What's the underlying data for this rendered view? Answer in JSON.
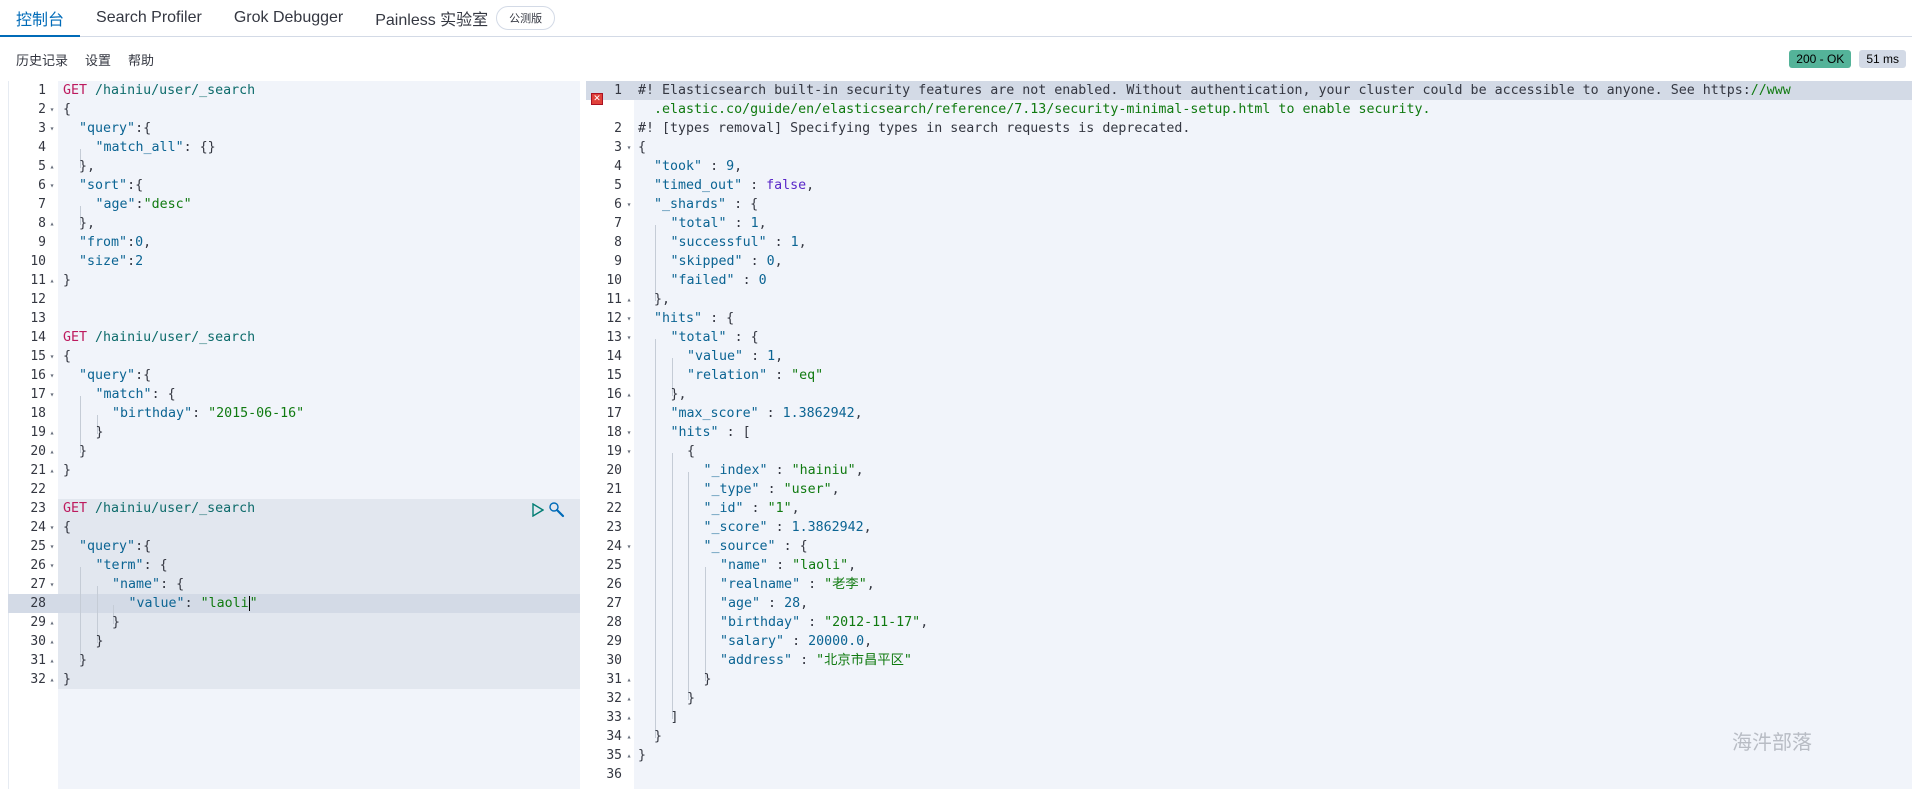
{
  "tabs": [
    {
      "label": "控制台",
      "active": true
    },
    {
      "label": "Search Profiler",
      "active": false
    },
    {
      "label": "Grok Debugger",
      "active": false
    },
    {
      "label": "Painless 实验室",
      "active": false,
      "badge": "公测版"
    }
  ],
  "subbar": {
    "history": "历史记录",
    "settings": "设置",
    "help": "帮助"
  },
  "status": {
    "code": "200 - OK",
    "time": "51 ms",
    "ok_color": "#54b399"
  },
  "request": {
    "lines": [
      {
        "n": "1",
        "fold": "",
        "html": "<span class='m'>GET</span> <span class='url'>/hainiu/user/_search</span>"
      },
      {
        "n": "2",
        "fold": "▾",
        "html": "{"
      },
      {
        "n": "3",
        "fold": "▾",
        "html": "  <span class='k'>\"query\"</span>:{"
      },
      {
        "n": "4",
        "fold": "",
        "html": "  <span class='guide'></span><span class='k'>\"match_all\"</span>: {}"
      },
      {
        "n": "5",
        "fold": "▴",
        "html": "  },"
      },
      {
        "n": "6",
        "fold": "▾",
        "html": "  <span class='k'>\"sort\"</span>:{"
      },
      {
        "n": "7",
        "fold": "",
        "html": "  <span class='guide'></span><span class='k'>\"age\"</span>:<span class='s'>\"desc\"</span>"
      },
      {
        "n": "8",
        "fold": "▴",
        "html": "  },"
      },
      {
        "n": "9",
        "fold": "",
        "html": "  <span class='k'>\"from\"</span>:<span class='n'>0</span>,"
      },
      {
        "n": "10",
        "fold": "",
        "html": "  <span class='k'>\"size\"</span>:<span class='n'>2</span>"
      },
      {
        "n": "11",
        "fold": "▴",
        "html": "}"
      },
      {
        "n": "12",
        "fold": "",
        "html": ""
      },
      {
        "n": "13",
        "fold": "",
        "html": ""
      },
      {
        "n": "14",
        "fold": "",
        "html": "<span class='m'>GET</span> <span class='url'>/hainiu/user/_search</span>"
      },
      {
        "n": "15",
        "fold": "▾",
        "html": "{"
      },
      {
        "n": "16",
        "fold": "▾",
        "html": "  <span class='k'>\"query\"</span>:{"
      },
      {
        "n": "17",
        "fold": "▾",
        "html": "  <span class='guide'></span><span class='k'>\"match\"</span>: {"
      },
      {
        "n": "18",
        "fold": "",
        "html": "  <span class='guide'></span><span class='guide'></span><span class='k'>\"birthday\"</span>: <span class='s'>\"2015-06-16\"</span>"
      },
      {
        "n": "19",
        "fold": "▴",
        "html": "  <span class='guide'></span>}"
      },
      {
        "n": "20",
        "fold": "▴",
        "html": "  }"
      },
      {
        "n": "21",
        "fold": "▴",
        "html": "}"
      },
      {
        "n": "22",
        "fold": "",
        "html": ""
      },
      {
        "n": "23",
        "fold": "",
        "html": "<span class='m'>GET</span> <span class='url'>/hainiu/user/_search</span>"
      },
      {
        "n": "24",
        "fold": "▾",
        "html": "{"
      },
      {
        "n": "25",
        "fold": "▾",
        "html": "  <span class='k'>\"query\"</span>:{"
      },
      {
        "n": "26",
        "fold": "▾",
        "html": "  <span class='guide'></span><span class='k'>\"term\"</span>: {"
      },
      {
        "n": "27",
        "fold": "▾",
        "html": "  <span class='guide'></span><span class='guide'></span><span class='k'>\"name\"</span>: {"
      },
      {
        "n": "28",
        "fold": "",
        "html": "  <span class='guide'></span><span class='guide'></span><span class='guide'></span><span class='k'>\"value\"</span>: <span class='s'>\"laoli</span><span class='cursor'></span><span class='s'>\"</span>"
      },
      {
        "n": "29",
        "fold": "▴",
        "html": "  <span class='guide'></span><span class='guide'></span>}"
      },
      {
        "n": "30",
        "fold": "▴",
        "html": "  <span class='guide'></span>}"
      },
      {
        "n": "31",
        "fold": "▴",
        "html": "  }"
      },
      {
        "n": "32",
        "fold": "▴",
        "html": "}"
      }
    ]
  },
  "response": {
    "lines": [
      {
        "n": "1",
        "fold": "",
        "html": "<span class='c'>#! Elasticsearch built-in security features are not enabled. Without authentication, your cluster could be accessible to anyone. See https:</span><span class='cu'>//www</span>",
        "wrap": "<span class='cu'>  .elastic.co/guide/en/elasticsearch/reference/7.13/security-minimal-setup.html to enable security.</span>"
      },
      {
        "n": "2",
        "fold": "",
        "html": "<span class='c'>#! [types removal] Specifying types in search requests is deprecated.</span>"
      },
      {
        "n": "3",
        "fold": "▾",
        "html": "{"
      },
      {
        "n": "4",
        "fold": "",
        "html": "  <span class='k'>\"took\"</span> : <span class='n'>9</span>,"
      },
      {
        "n": "5",
        "fold": "",
        "html": "  <span class='k'>\"timed_out\"</span> : <span class='b'>false</span>,"
      },
      {
        "n": "6",
        "fold": "▾",
        "html": "  <span class='k'>\"_shards\"</span> : {"
      },
      {
        "n": "7",
        "fold": "",
        "html": "  <span class='guide'></span><span class='k'>\"total\"</span> : <span class='n'>1</span>,"
      },
      {
        "n": "8",
        "fold": "",
        "html": "  <span class='guide'></span><span class='k'>\"successful\"</span> : <span class='n'>1</span>,"
      },
      {
        "n": "9",
        "fold": "",
        "html": "  <span class='guide'></span><span class='k'>\"skipped\"</span> : <span class='n'>0</span>,"
      },
      {
        "n": "10",
        "fold": "",
        "html": "  <span class='guide'></span><span class='k'>\"failed\"</span> : <span class='n'>0</span>"
      },
      {
        "n": "11",
        "fold": "▴",
        "html": "  },"
      },
      {
        "n": "12",
        "fold": "▾",
        "html": "  <span class='k'>\"hits\"</span> : {"
      },
      {
        "n": "13",
        "fold": "▾",
        "html": "  <span class='guide'></span><span class='k'>\"total\"</span> : {"
      },
      {
        "n": "14",
        "fold": "",
        "html": "  <span class='guide'></span><span class='guide'></span><span class='k'>\"value\"</span> : <span class='n'>1</span>,"
      },
      {
        "n": "15",
        "fold": "",
        "html": "  <span class='guide'></span><span class='guide'></span><span class='k'>\"relation\"</span> : <span class='s'>\"eq\"</span>"
      },
      {
        "n": "16",
        "fold": "▴",
        "html": "  <span class='guide'></span>},"
      },
      {
        "n": "17",
        "fold": "",
        "html": "  <span class='guide'></span><span class='k'>\"max_score\"</span> : <span class='n'>1.3862942</span>,"
      },
      {
        "n": "18",
        "fold": "▾",
        "html": "  <span class='guide'></span><span class='k'>\"hits\"</span> : ["
      },
      {
        "n": "19",
        "fold": "▾",
        "html": "  <span class='guide'></span><span class='guide'></span>{"
      },
      {
        "n": "20",
        "fold": "",
        "html": "  <span class='guide'></span><span class='guide'></span><span class='guide'></span><span class='k'>\"_index\"</span> : <span class='s'>\"hainiu\"</span>,"
      },
      {
        "n": "21",
        "fold": "",
        "html": "  <span class='guide'></span><span class='guide'></span><span class='guide'></span><span class='k'>\"_type\"</span> : <span class='s'>\"user\"</span>,"
      },
      {
        "n": "22",
        "fold": "",
        "html": "  <span class='guide'></span><span class='guide'></span><span class='guide'></span><span class='k'>\"_id\"</span> : <span class='s'>\"1\"</span>,"
      },
      {
        "n": "23",
        "fold": "",
        "html": "  <span class='guide'></span><span class='guide'></span><span class='guide'></span><span class='k'>\"_score\"</span> : <span class='n'>1.3862942</span>,"
      },
      {
        "n": "24",
        "fold": "▾",
        "html": "  <span class='guide'></span><span class='guide'></span><span class='guide'></span><span class='k'>\"_source\"</span> : {"
      },
      {
        "n": "25",
        "fold": "",
        "html": "  <span class='guide'></span><span class='guide'></span><span class='guide'></span><span class='guide'></span><span class='k'>\"name\"</span> : <span class='s'>\"laoli\"</span>,"
      },
      {
        "n": "26",
        "fold": "",
        "html": "  <span class='guide'></span><span class='guide'></span><span class='guide'></span><span class='guide'></span><span class='k'>\"realname\"</span> : <span class='s'>\"老李\"</span>,"
      },
      {
        "n": "27",
        "fold": "",
        "html": "  <span class='guide'></span><span class='guide'></span><span class='guide'></span><span class='guide'></span><span class='k'>\"age\"</span> : <span class='n'>28</span>,"
      },
      {
        "n": "28",
        "fold": "",
        "html": "  <span class='guide'></span><span class='guide'></span><span class='guide'></span><span class='guide'></span><span class='k'>\"birthday\"</span> : <span class='s'>\"2012-11-17\"</span>,"
      },
      {
        "n": "29",
        "fold": "",
        "html": "  <span class='guide'></span><span class='guide'></span><span class='guide'></span><span class='guide'></span><span class='k'>\"salary\"</span> : <span class='n'>20000.0</span>,"
      },
      {
        "n": "30",
        "fold": "",
        "html": "  <span class='guide'></span><span class='guide'></span><span class='guide'></span><span class='guide'></span><span class='k'>\"address\"</span> : <span class='s'>\"北京市昌平区\"</span>"
      },
      {
        "n": "31",
        "fold": "▴",
        "html": "  <span class='guide'></span><span class='guide'></span><span class='guide'></span>}"
      },
      {
        "n": "32",
        "fold": "▴",
        "html": "  <span class='guide'></span><span class='guide'></span>}"
      },
      {
        "n": "33",
        "fold": "▴",
        "html": "  <span class='guide'></span>]"
      },
      {
        "n": "34",
        "fold": "▴",
        "html": "  }"
      },
      {
        "n": "35",
        "fold": "▴",
        "html": "}"
      },
      {
        "n": "36",
        "fold": "",
        "html": ""
      }
    ]
  },
  "watermark": "海汼部落"
}
